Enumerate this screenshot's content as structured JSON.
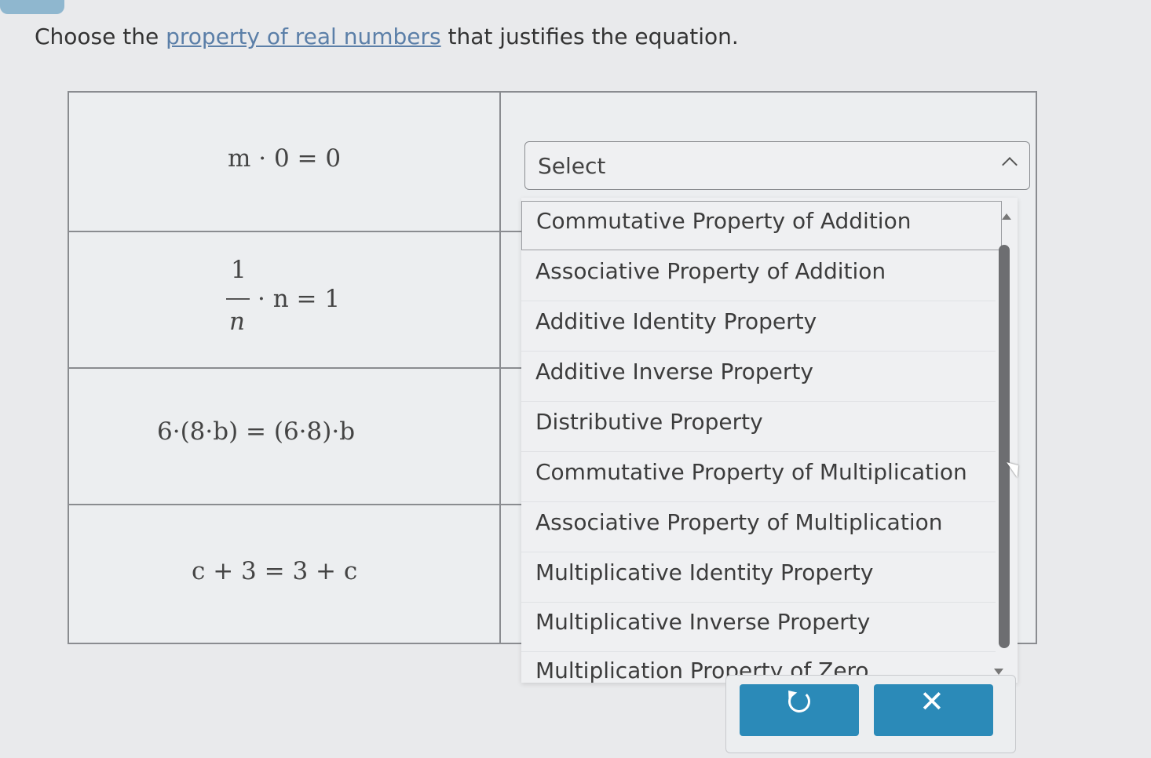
{
  "prompt": {
    "before": "Choose the ",
    "link": "property of real numbers",
    "after": " that justifies the equation."
  },
  "equations": [
    {
      "text": "m · 0 = 0"
    },
    {
      "numerator": "1",
      "denominator": "n",
      "rest": "· n = 1"
    },
    {
      "text": "6·(8·b) = (6·8)·b"
    },
    {
      "text": "c + 3 = 3 + c"
    }
  ],
  "select": {
    "placeholder": "Select"
  },
  "dropdown": {
    "options": [
      "Commutative Property of Addition",
      "Associative Property of Addition",
      "Additive Identity Property",
      "Additive Inverse Property",
      "Distributive Property",
      "Commutative Property of Multiplication",
      "Associative Property of Multiplication",
      "Multiplicative Identity Property",
      "Multiplicative Inverse Property",
      "Multiplication Property of Zero"
    ],
    "highlighted_index": 0
  },
  "actions": {
    "undo_icon": "undo-icon",
    "clear_icon": "close-icon",
    "clear_glyph": "✕"
  },
  "colors": {
    "button": "#2b8ab8",
    "link": "#5b7fa8",
    "background": "#e9eaec"
  }
}
